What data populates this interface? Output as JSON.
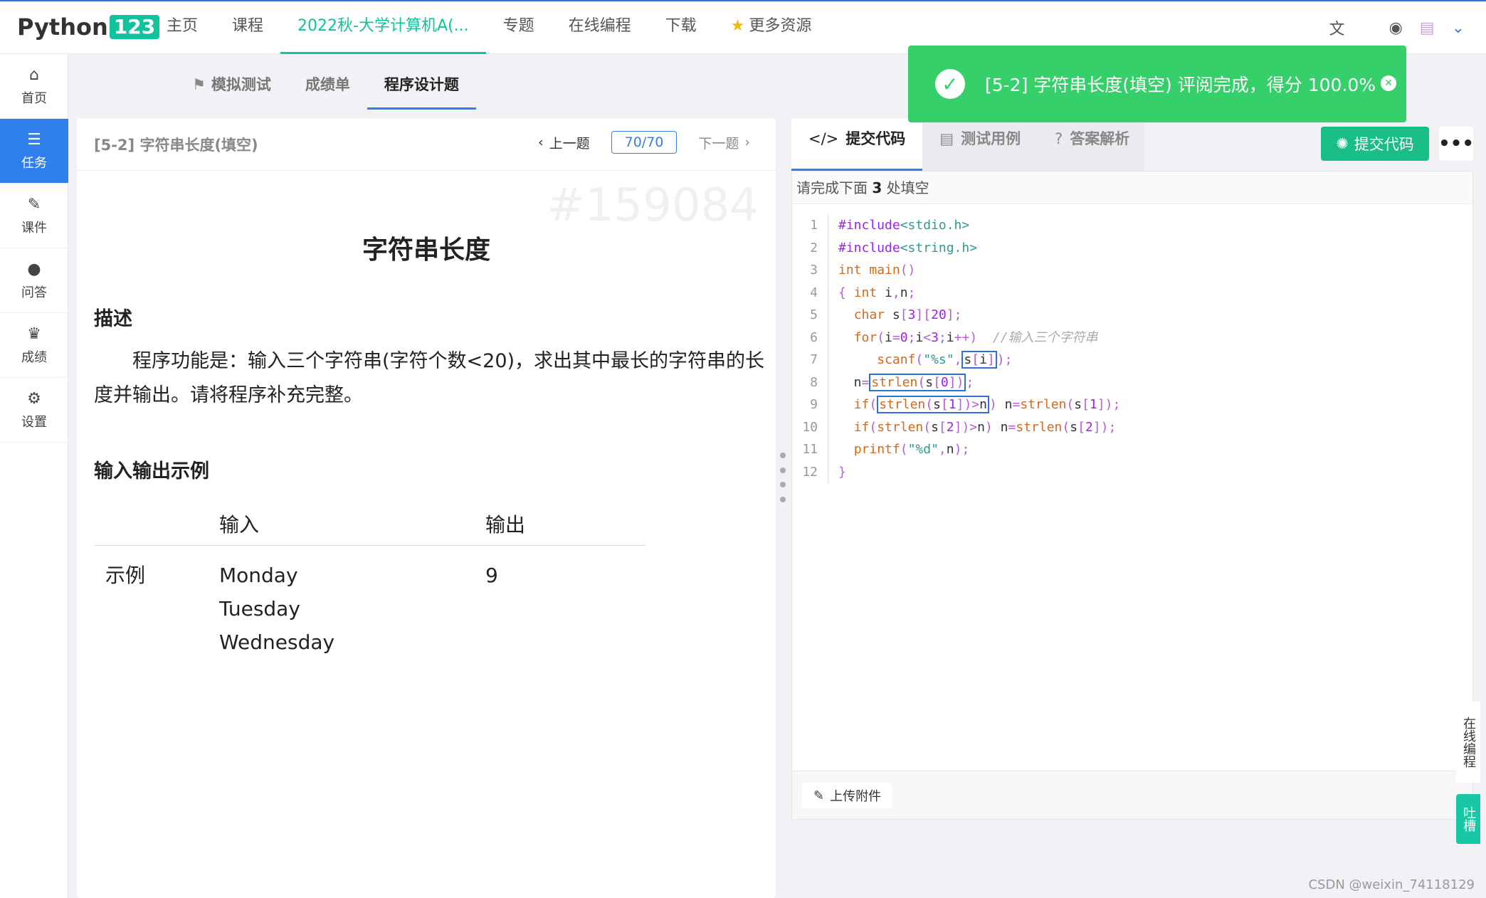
{
  "logo": {
    "text": "Python",
    "badge": "123"
  },
  "nav": {
    "items": [
      "主页",
      "课程",
      "2022秋-大学计算机A(...",
      "专题",
      "在线编程",
      "下载"
    ],
    "more": "更多资源"
  },
  "sidebar": {
    "items": [
      {
        "icon": "home-icon",
        "label": "首页"
      },
      {
        "icon": "tasks-icon",
        "label": "任务"
      },
      {
        "icon": "paperclip-icon",
        "label": "课件"
      },
      {
        "icon": "comments-icon",
        "label": "问答"
      },
      {
        "icon": "trophy-icon",
        "label": "成绩"
      },
      {
        "icon": "gear-icon",
        "label": "设置"
      }
    ]
  },
  "subtabs": [
    "模拟测试",
    "成绩单",
    "程序设计题"
  ],
  "problem": {
    "header_title": "[5-2] 字符串长度(填空)",
    "prev": "上一题",
    "counter": "70/70",
    "next": "下一题",
    "id_watermark": "#159084",
    "title": "字符串长度",
    "section_desc": "描述",
    "description": "程序功能是：输入三个字符串(字符个数<20)，求出其中最长的字符串的长度并输出。请将程序补充完整。",
    "section_io": "输入输出示例",
    "io_headers": [
      "输入",
      "输出"
    ],
    "example_label": "示例",
    "example_input": [
      "Monday",
      "Tuesday",
      "Wednesday"
    ],
    "example_output": "9"
  },
  "editor": {
    "tabs": [
      "提交代码",
      "测试用例",
      "答案解析"
    ],
    "submit": "提交代码",
    "more": "•••",
    "hint_prefix": "请完成下面 ",
    "hint_count": "3",
    "hint_suffix": " 处填空",
    "upload": "上传附件"
  },
  "toast": {
    "message": "[5-2] 字符串长度(填空) 评阅完成，得分 100.0%"
  },
  "side_tabs": {
    "online": "在线编程",
    "feedback": "吐槽"
  },
  "footer_watermark": "CSDN @weixin_74118129",
  "colors": {
    "accent": "#11c29b",
    "primary": "#2f80ed",
    "success": "#35d06a"
  }
}
